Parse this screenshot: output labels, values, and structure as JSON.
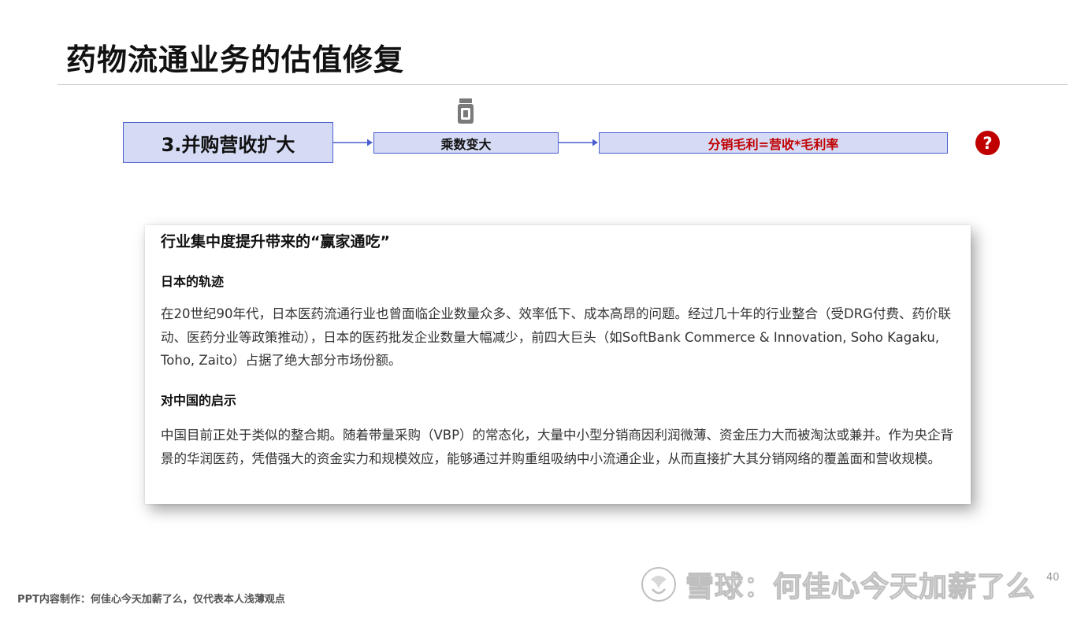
{
  "slide": {
    "title": "药物流通业务的估值修复",
    "page_number": "40"
  },
  "flow": {
    "step_main": "3.并购营收扩大",
    "step_mid": "乘数变大",
    "step_right": "分销毛利=营收*毛利率",
    "question_mark": "?",
    "icon_top": "medicine-bottle-icon",
    "accent_color": "#c00000",
    "box_fill": "#d6dbf5",
    "box_border": "#4a5fcf"
  },
  "card": {
    "heading": "行业集中度提升带来的“赢家通吃”",
    "section1_title": "日本的轨迹",
    "section1_text": "在20世纪90年代，日本医药流通行业也曾面临企业数量众多、效率低下、成本高昂的问题。经过几十年的行业整合（受DRG付费、药价联动、医药分业等政策推动），日本的医药批发企业数量大幅减少，前四大巨头（如SoftBank Commerce & Innovation, Soho Kagaku, Toho, Zaito）占据了绝大部分市场份额。",
    "section2_title": "对中国的启示",
    "section2_text": "中国目前正处于类似的整合期。随着带量采购（VBP）的常态化，大量中小型分销商因利润微薄、资金压力大而被淘汰或兼并。作为央企背景的华润医药，凭借强大的资金实力和规模效应，能够通过并购重组吸纳中小流通企业，从而直接扩大其分销网络的覆盖面和营收规模。"
  },
  "footer": {
    "credit": "PPT内容制作：何佳心今天加薪了么，仅代表本人浅薄观点"
  },
  "watermark": {
    "text": "雪球：何佳心今天加薪了么",
    "icon": "snowball-logo-icon"
  }
}
